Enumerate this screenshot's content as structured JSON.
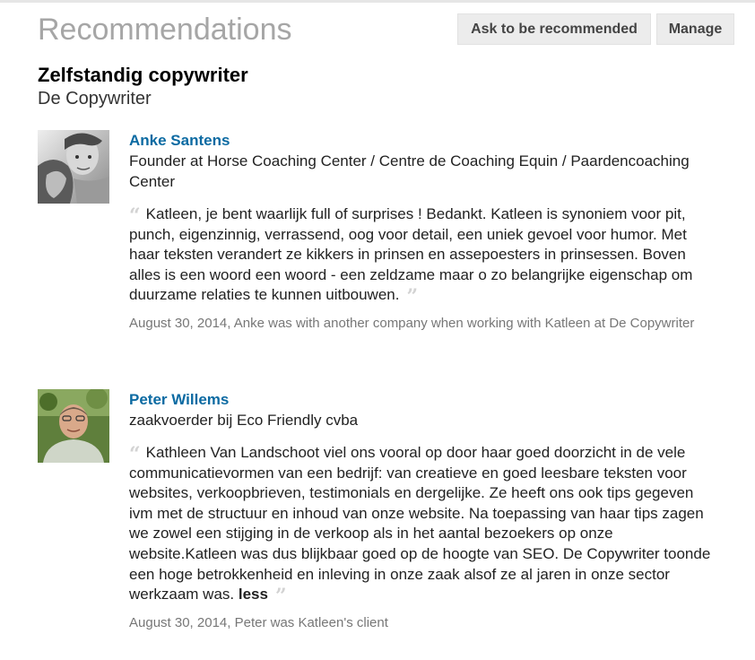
{
  "section": {
    "title": "Recommendations",
    "ask_label": "Ask to be recommended",
    "manage_label": "Manage"
  },
  "position": {
    "title": "Zelfstandig copywriter",
    "company": "De Copywriter"
  },
  "recommendations": [
    {
      "name": "Anke Santens",
      "headline": "Founder at Horse Coaching Center / Centre de Coaching Equin / Paardencoaching Center",
      "text": "Katleen, je bent waarlijk full of surprises ! Bedankt. Katleen is synoniem voor pit, punch, eigenzinnig, verrassend, oog voor detail, een uniek gevoel voor humor. Met haar teksten verandert ze kikkers in prinsen en assepoesters in prinsessen. Boven alles is een woord een woord - een zeldzame maar o zo belangrijke eigenschap om duurzame relaties te kunnen uitbouwen.",
      "meta": "August 30, 2014, Anke was with another company when working with Katleen at De Copywriter"
    },
    {
      "name": "Peter Willems",
      "headline": "zaakvoerder bij Eco Friendly cvba",
      "text": "Kathleen Van Landschoot viel ons vooral op door haar goed doorzicht in de vele communicatievormen van een bedrijf: van creatieve en goed leesbare teksten voor websites, verkoopbrieven, testimonials en dergelijke. Ze heeft ons ook tips gegeven ivm met de structuur en inhoud van onze website. Na toepassing van haar tips zagen we zowel een stijging in de verkoop als in het aantal bezoekers op onze website.Katleen was dus blijkbaar goed op de hoogte van SEO. De Copywriter toonde een hoge betrokkenheid en inleving in onze zaak alsof ze al jaren in onze sector werkzaam was.",
      "less_label": "less",
      "meta": "August 30, 2014, Peter was Katleen's client"
    }
  ],
  "colors": {
    "name_link": "#0b6aa2",
    "title_gray": "#a6a6a6",
    "meta_gray": "#777777",
    "button_bg": "#ececec"
  },
  "icons": {
    "open_quote": "quote-open-icon",
    "close_quote": "quote-close-icon"
  }
}
